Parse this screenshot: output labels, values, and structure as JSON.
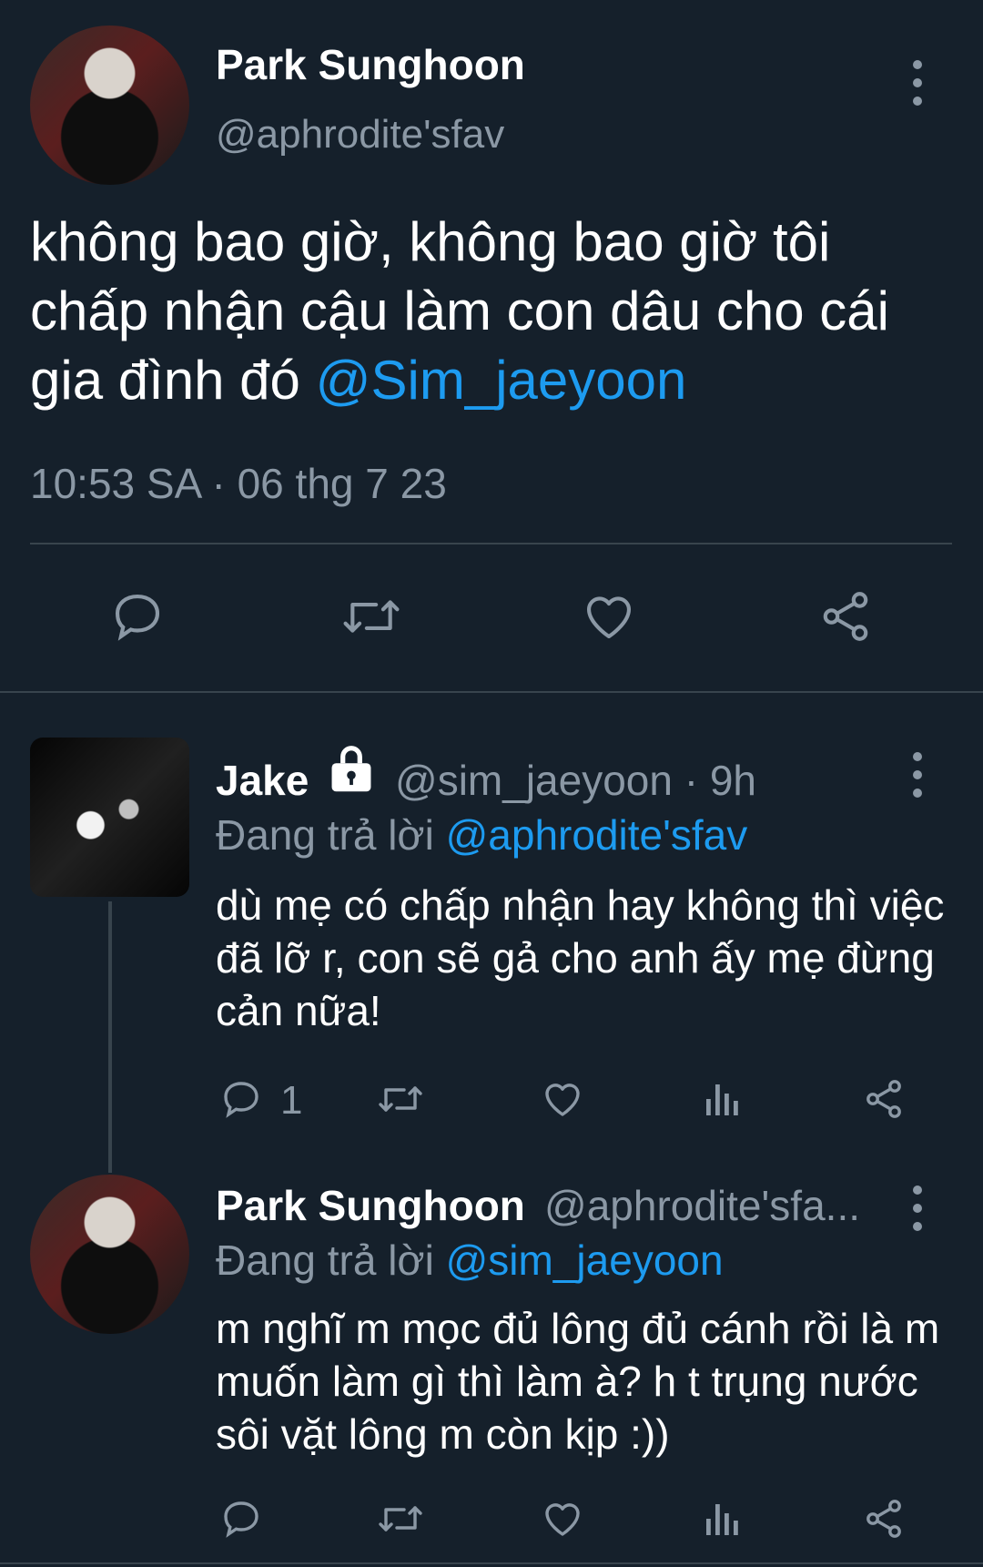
{
  "main_tweet": {
    "name": "Park Sunghoon",
    "handle": "@aphrodite'sfav",
    "text_plain": "không bao giờ, không bao giờ tôi chấp nhận cậu làm con dâu cho cái gia đình đó ",
    "mention": "@Sim_jaeyoon",
    "timestamp": "10:53 SA · 06 thg 7 23"
  },
  "reply1": {
    "name": "Jake",
    "handle_time": "@sim_jaeyoon · 9h",
    "replying_prefix": "Đang trả lời ",
    "replying_to": "@aphrodite'sfav",
    "text": "dù mẹ có chấp nhận hay không thì việc đã lỡ r, con sẽ gả cho anh ấy mẹ đừng cản nữa!",
    "reply_count": "1"
  },
  "reply2": {
    "name": "Park Sunghoon",
    "handle": "@aphrodite'sfa...",
    "replying_prefix": "Đang trả lời ",
    "replying_to": "@sim_jaeyoon",
    "text": "m nghĩ m mọc đủ lông đủ cánh rồi là m muốn làm gì thì làm à? h t trụng nước sôi vặt lông m còn kịp :))"
  },
  "icons": {
    "reply": "reply-icon",
    "retweet": "retweet-icon",
    "like": "heart-icon",
    "share": "share-icon",
    "views": "views-icon",
    "lock": "lock-icon",
    "more": "more-vertical-icon"
  },
  "colors": {
    "background": "#15202b",
    "text": "#ffffff",
    "muted": "#8b98a5",
    "link": "#1d9bf0",
    "divider": "#38444d"
  }
}
